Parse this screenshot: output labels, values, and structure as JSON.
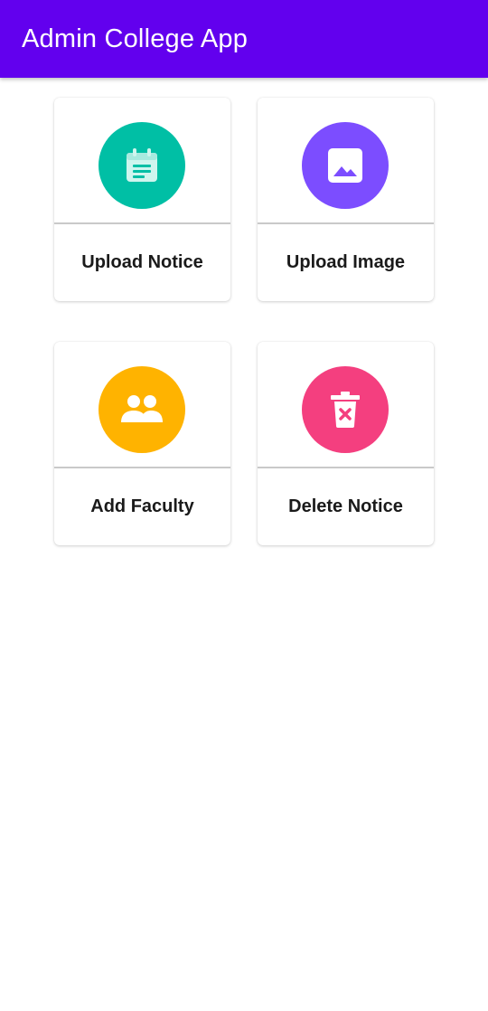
{
  "app_bar": {
    "title": "Admin College App",
    "color": "#6200EE"
  },
  "cards": [
    {
      "label": "Upload Notice",
      "icon": "notice-icon",
      "color": "#00BFA5"
    },
    {
      "label": "Upload Image",
      "icon": "image-icon",
      "color": "#7C4DFF"
    },
    {
      "label": "Add Faculty",
      "icon": "people-icon",
      "color": "#FFB300"
    },
    {
      "label": "Delete Notice",
      "icon": "delete-icon",
      "color": "#F43F7F"
    }
  ]
}
